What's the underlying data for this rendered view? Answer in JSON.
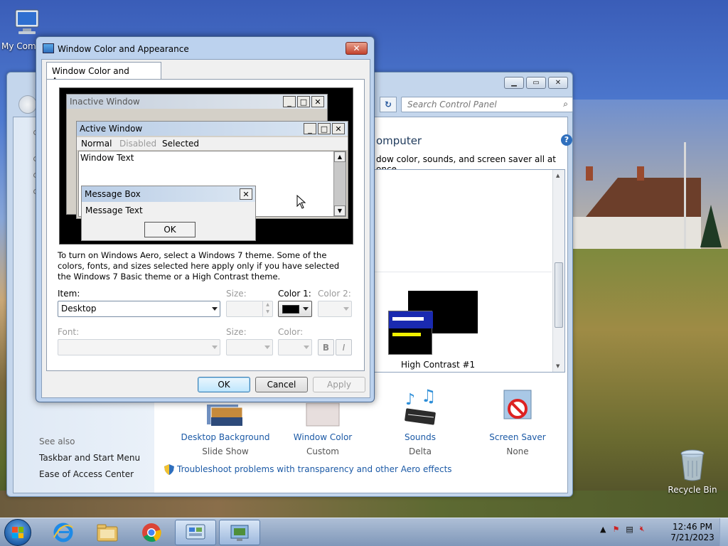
{
  "desktop": {
    "icons": [
      {
        "label": "My Computer"
      },
      {
        "label": "Recycle Bin"
      }
    ]
  },
  "control_panel": {
    "search_placeholder": "Search Control Panel",
    "heading": "omputer",
    "subheading": "dow color, sounds, and screen saver all at once.",
    "theme_label": "High Contrast #1",
    "see_also": "See also",
    "links": [
      "Taskbar and Start Menu",
      "Ease of Access Center"
    ],
    "customizers": [
      {
        "label": "Desktop Background",
        "value": "Slide Show",
        "icon": "desktop-background-icon"
      },
      {
        "label": "Window Color",
        "value": "Custom",
        "icon": "window-color-icon"
      },
      {
        "label": "Sounds",
        "value": "Delta",
        "icon": "sounds-icon"
      },
      {
        "label": "Screen Saver",
        "value": "None",
        "icon": "screen-saver-icon"
      }
    ],
    "troubleshoot": "Troubleshoot problems with transparency and other Aero effects"
  },
  "dialog": {
    "title": "Window Color and Appearance",
    "tab": "Window Color and Appearance",
    "preview": {
      "inactive_title": "Inactive Window",
      "active_title": "Active Window",
      "menu": [
        "Normal",
        "Disabled",
        "Selected"
      ],
      "window_text": "Window Text",
      "message_title": "Message Box",
      "message_text": "Message Text",
      "message_ok": "OK"
    },
    "note": "To turn on Windows Aero, select a Windows 7 theme.  Some of the colors, fonts, and sizes selected here apply only if you have selected the Windows 7 Basic theme or a High Contrast theme.",
    "labels": {
      "item": "Item:",
      "size": "Size:",
      "color1": "Color 1:",
      "color2": "Color 2:",
      "font": "Font:",
      "font_size": "Size:",
      "font_color": "Color:"
    },
    "item_value": "Desktop",
    "color1_value": "#000000",
    "bold": "B",
    "italic": "I",
    "buttons": {
      "ok": "OK",
      "cancel": "Cancel",
      "apply": "Apply"
    }
  },
  "taskbar": {
    "time": "12:46 PM",
    "date": "7/21/2023",
    "pinned": [
      "internet-explorer-icon",
      "folder-icon",
      "chrome-icon",
      "control-panel-icon",
      "window-color-icon"
    ]
  }
}
